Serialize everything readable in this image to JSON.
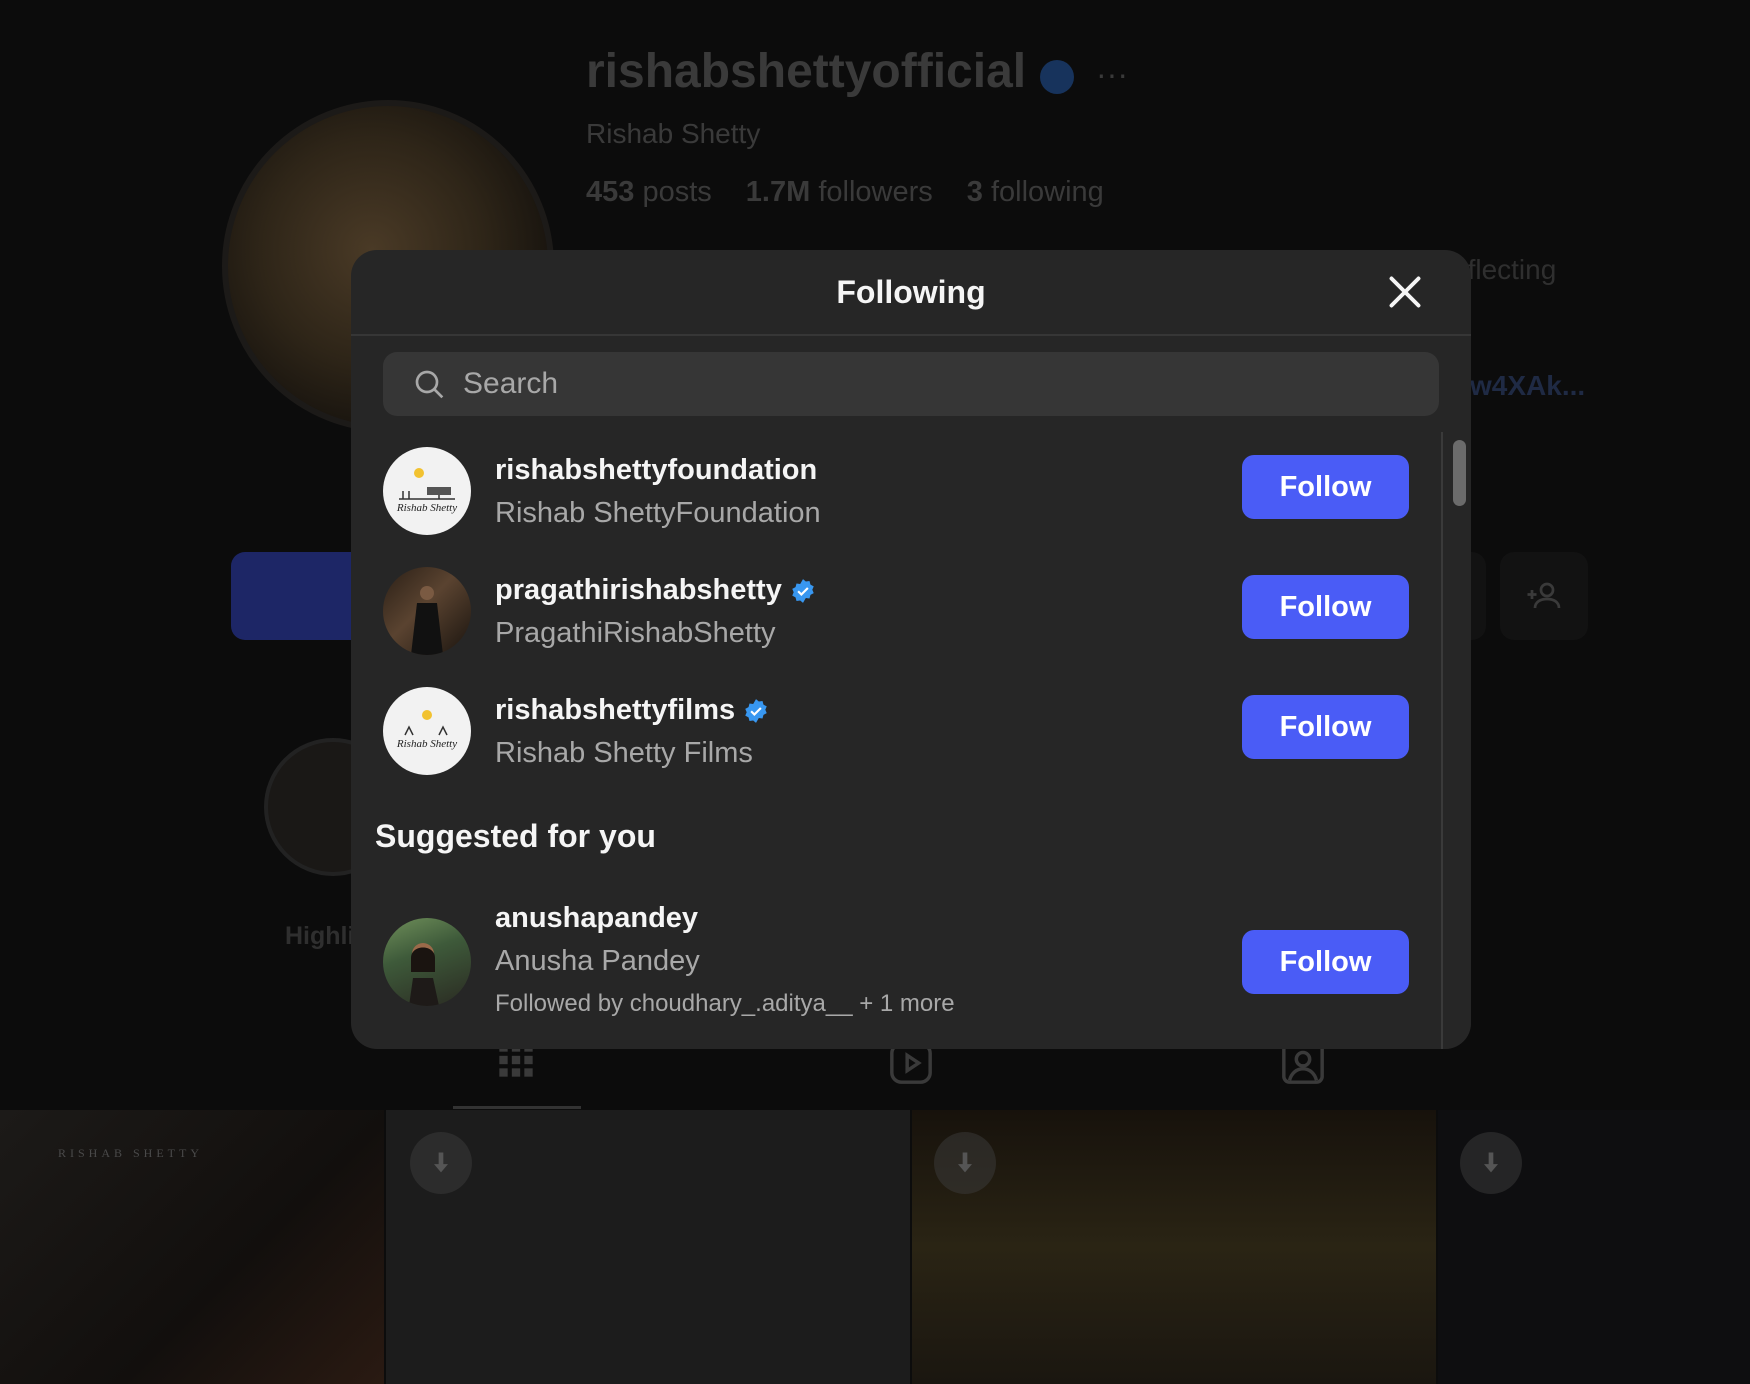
{
  "background": {
    "username": "rishabshettyofficial",
    "more_label": "···",
    "full_name": "Rishab Shetty",
    "stats": [
      {
        "value": "453",
        "label": "posts"
      },
      {
        "value": "1.7M",
        "label": "followers"
      },
      {
        "value": "3",
        "label": "following"
      }
    ],
    "bio_fragment": "eflecting",
    "link_fragment": "w4XAk...",
    "highlight_label": "Highli",
    "tile_caption": "RISHAB SHETTY"
  },
  "modal": {
    "title": "Following",
    "search_placeholder": "Search",
    "following": [
      {
        "username": "rishabshettyfoundation",
        "full_name": "Rishab ShettyFoundation",
        "verified": false,
        "button": "Follow",
        "avatar": "foundation-logo"
      },
      {
        "username": "pragathirishabshetty",
        "full_name": "PragathiRishabShetty",
        "verified": true,
        "button": "Follow",
        "avatar": "person-photo"
      },
      {
        "username": "rishabshettyfilms",
        "full_name": "Rishab Shetty Films",
        "verified": true,
        "button": "Follow",
        "avatar": "films-logo"
      }
    ],
    "suggested_title": "Suggested for you",
    "suggested": [
      {
        "username": "anushapandey",
        "full_name": "Anusha Pandey",
        "mutual": "Followed by choudhary_.aditya__ + 1 more",
        "button": "Follow",
        "avatar": "person-photo"
      }
    ]
  },
  "colors": {
    "accent": "#4a5cf6",
    "verified": "#3897f0",
    "modal_bg": "#262626",
    "secondary_text": "#a8a8a8"
  }
}
